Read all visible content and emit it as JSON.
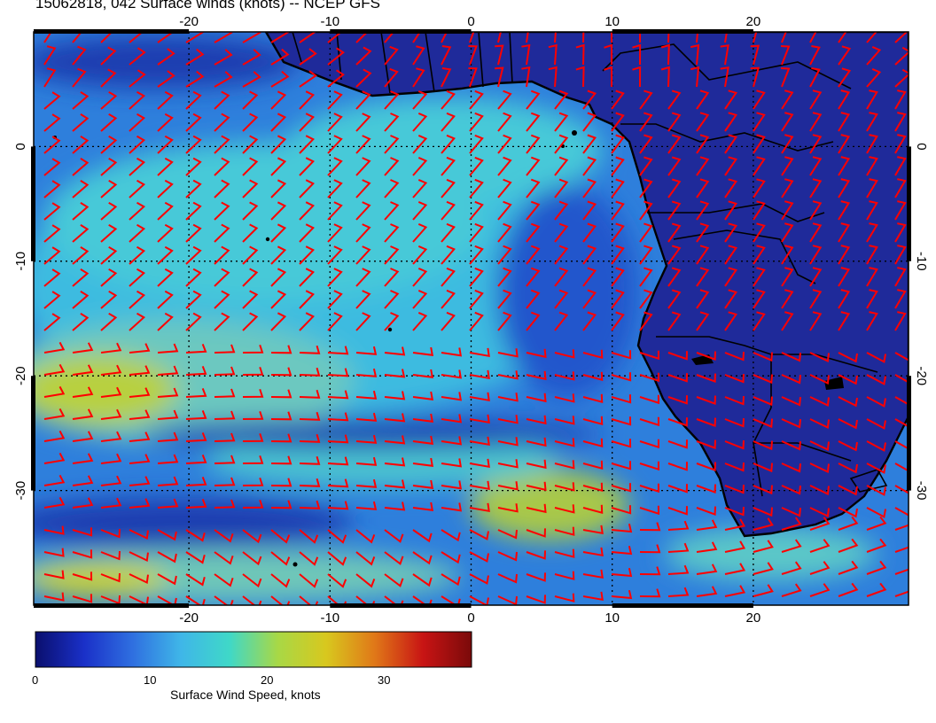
{
  "title": "15062818, 042 Surface winds (knots) -- NCEP GFS",
  "map": {
    "lon_range": [
      -31,
      31
    ],
    "lat_range": [
      -40,
      10
    ],
    "lon_ticks": [
      "-20",
      "-10",
      "0",
      "10",
      "20"
    ],
    "lat_ticks": [
      "0",
      "-10",
      "-20",
      "-30"
    ],
    "lon_tick_values": [
      -20,
      -10,
      0,
      10,
      20
    ],
    "lat_tick_values": [
      0,
      -10,
      -20,
      -30
    ],
    "graticule": "dotted",
    "barb_color": "#ff0000",
    "coast_color": "#000000"
  },
  "colorbar": {
    "title": "Surface Wind Speed, knots",
    "labels": [
      "0",
      "10",
      "20",
      "30"
    ],
    "values": [
      0,
      10,
      20,
      30
    ],
    "range": [
      0,
      37.5
    ],
    "colors": [
      "#0a0f6e",
      "#1a30c8",
      "#2f6fe0",
      "#3fb6e8",
      "#3fd8c8",
      "#a8d846",
      "#d8c81e",
      "#e07818",
      "#c81414",
      "#7a0a0a"
    ]
  }
}
